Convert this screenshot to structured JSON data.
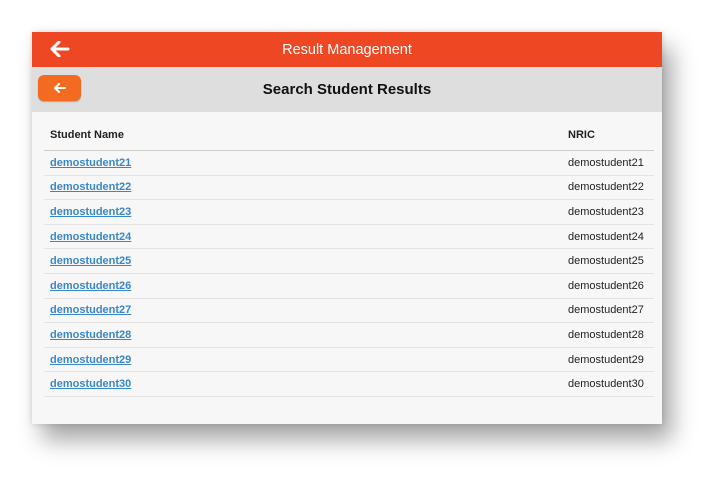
{
  "header": {
    "title": "Result Management",
    "back_icon": "arrow-left-icon",
    "color": "#ee4723"
  },
  "subheader": {
    "title": "Search Student Results",
    "back_icon": "arrow-left-icon",
    "back_color": "#f36b21"
  },
  "table": {
    "columns": [
      "Student Name",
      "NRIC"
    ],
    "rows": [
      {
        "name": "demostudent21",
        "nric": "demostudent21"
      },
      {
        "name": "demostudent22",
        "nric": "demostudent22"
      },
      {
        "name": "demostudent23",
        "nric": "demostudent23"
      },
      {
        "name": "demostudent24",
        "nric": "demostudent24"
      },
      {
        "name": "demostudent25",
        "nric": "demostudent25"
      },
      {
        "name": "demostudent26",
        "nric": "demostudent26"
      },
      {
        "name": "demostudent27",
        "nric": "demostudent27"
      },
      {
        "name": "demostudent28",
        "nric": "demostudent28"
      },
      {
        "name": "demostudent29",
        "nric": "demostudent29"
      },
      {
        "name": "demostudent30",
        "nric": "demostudent30"
      }
    ],
    "link_color": "#3a87c8"
  }
}
